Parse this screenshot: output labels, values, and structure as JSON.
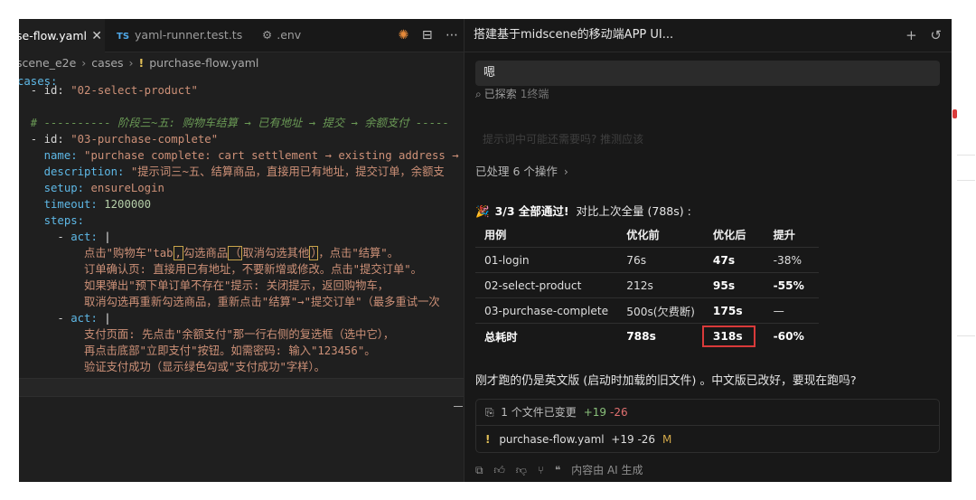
{
  "editor": {
    "tabs": [
      {
        "label": "se-flow.yaml",
        "close": "✕"
      },
      {
        "badge": "TS",
        "label": "yaml-runner.test.ts"
      },
      {
        "icon": "gear-icon",
        "label": ".env"
      }
    ],
    "breadcrumb": [
      "scene_e2e",
      "cases",
      "purchase-flow.yaml"
    ],
    "code": {
      "l1": "cases:",
      "l2a": "  - id: ",
      "l2b": "\"02-select-product\"",
      "l3": "  # ---------- 阶段三~五: 购物车结算 → 已有地址 → 提交 → 余额支付 -----",
      "l4a": "  - id: ",
      "l4b": "\"03-purchase-complete\"",
      "l5a": "    name: ",
      "l5b": "\"purchase complete: cart settlement → existing address →",
      "l6a": "    description: ",
      "l6b": "\"提示词三~五、结算商品，直接用已有地址，提交订单，余额支",
      "l7a": "    setup: ",
      "l7b": "ensureLogin",
      "l8a": "    timeout: ",
      "l8b": "1200000",
      "l9": "    steps:",
      "l10a": "      - ",
      "l10b": "act: ",
      "l10c": "|",
      "l11a": "          点击\"购物车\"tab",
      "l11b": ",",
      "l11c": "勾选商品",
      "l11d": "（",
      "l11e": "取消勾选其他",
      "l11f": "）",
      "l11g": "，点击\"结算\"。",
      "l12": "          订单确认页: 直接用已有地址，不要新增或修改。点击\"提交订单\"。",
      "l13": "          如果弹出\"预下单订单不存在\"提示: 关闭提示，返回购物车，",
      "l14": "          取消勾选再重新勾选商品，重新点击\"结算\"→\"提交订单\"（最多重试一次",
      "l15a": "      - ",
      "l15b": "act: ",
      "l15c": "|",
      "l16": "          支付页面: 先点击\"余额支付\"那一行右侧的复选框（选中它），",
      "l17": "          再点击底部\"立即支付\"按钮。如需密码: 输入\"123456\"。",
      "l18": "          验证支付成功（显示绿色勾或\"支付成功\"字样）。"
    }
  },
  "chat": {
    "title": "搭建基于midscene的移动端APP UI...",
    "user_message": "嗯",
    "explored": {
      "label": "已探索",
      "count": "1终端"
    },
    "faint": "提示词中可能还需要吗? 推测应该",
    "processed": "已处理 6 个操作",
    "summary": {
      "emoji": "🎉",
      "bold": "3/3 全部通过!",
      "rest": "对比上次全量 (788s) :"
    },
    "table": {
      "headers": [
        "用例",
        "优化前",
        "优化后",
        "提升"
      ],
      "rows": [
        {
          "case": "01-login",
          "before": "76s",
          "after": "47s",
          "gain": "-38%"
        },
        {
          "case": "02-select-product",
          "before": "212s",
          "after": "95s",
          "gain": "-55%"
        },
        {
          "case": "03-purchase-complete",
          "before": "500s(欠费断)",
          "after": "175s",
          "gain": "—"
        }
      ],
      "total": {
        "case": "总耗时",
        "before": "788s",
        "after": "318s",
        "gain": "-60%"
      }
    },
    "question": "刚才跑的仍是英文版 (启动时加载的旧文件) 。中文版已改好，要现在跑吗?",
    "changes": {
      "header": "1 个文件已变更",
      "add": "+19",
      "del": "-26"
    },
    "file": {
      "name": "purchase-flow.yaml",
      "add": "+19",
      "del": "-26",
      "status": "M"
    },
    "footer_label": "内容由 AI 生成"
  }
}
